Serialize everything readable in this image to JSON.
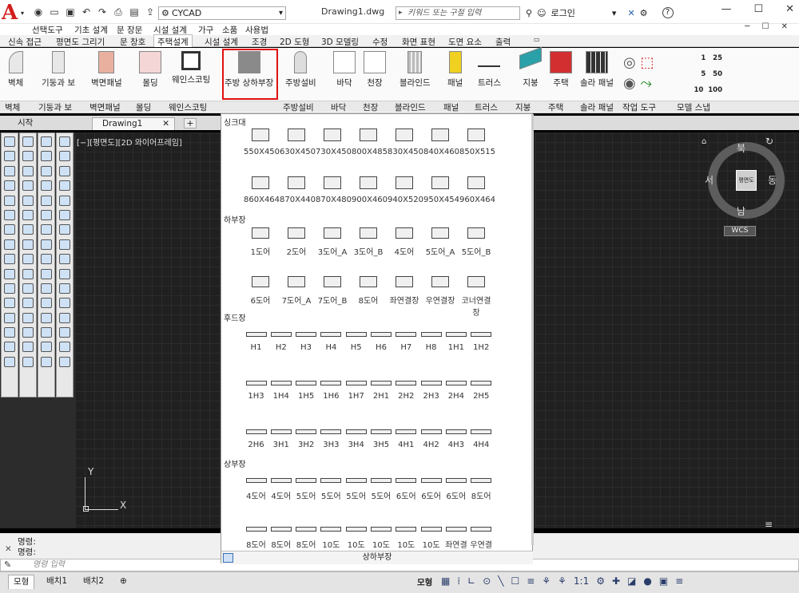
{
  "title": {
    "workspace": "CYCAD",
    "document": "Drawing1.dwg",
    "search_placeholder": "키워드 또는 구절 입력",
    "login": "로그인",
    "help": "?"
  },
  "menu": [
    "선택도구",
    "기초 설계",
    "문 장문",
    "시설 설계",
    "가구",
    "소품",
    "사용법"
  ],
  "ribbon_tabs": [
    "신속 접근",
    "평면도 그리기",
    "문 창호",
    "주택설계",
    "시설 설계",
    "조경",
    "2D 도형",
    "3D 모델링",
    "수정",
    "화면 표현",
    "도면 요소",
    "출력"
  ],
  "active_tab": "주택설계",
  "ribbon_buttons": [
    "벽체",
    "기둥과 보",
    "벽면패널",
    "몰딩",
    "웨인스코팅",
    "주방 상하부장",
    "주방설비",
    "바닥",
    "천장",
    "블라인드",
    "패널",
    "트러스",
    "지붕",
    "주택",
    "솔라 패널"
  ],
  "panel_labels": [
    "벽체",
    "기둥과 보",
    "벽면패널",
    "몰딩",
    "웨인스코팅",
    "주방설비",
    "바닥",
    "천장",
    "블라인드",
    "패널",
    "트러스",
    "지붕",
    "주택",
    "솔라 패널",
    "작업 도구",
    "모델 스냅"
  ],
  "snap_values": [
    "1",
    "25",
    "5",
    "50",
    "10",
    "100"
  ],
  "doc_tabs": {
    "start": "시작",
    "current": "Drawing1"
  },
  "viewport_label": "[−][평면도][2D 와이어프레임]",
  "viewcube": {
    "face": "평면도",
    "n": "북",
    "s": "남",
    "e": "동",
    "w": "서",
    "wcs": "WCS"
  },
  "ucs": {
    "x": "X",
    "y": "Y"
  },
  "command": {
    "line1": "명령:",
    "line2": "명령:",
    "placeholder": "명령 입력"
  },
  "layout_tabs": [
    "모형",
    "배치1",
    "배치2"
  ],
  "status_model": "모형",
  "status_scale": "1:1",
  "gallery": {
    "footer": "상하부장",
    "sections": [
      {
        "name": "싱크대",
        "rows": [
          [
            "550X450",
            "630X450",
            "730X450",
            "800X485",
            "830X450",
            "840X460",
            "850X515"
          ],
          [
            "860X464",
            "870X440",
            "870X480",
            "900X460",
            "940X520",
            "950X454",
            "960X464"
          ]
        ]
      },
      {
        "name": "하부장",
        "rows": [
          [
            "1도어",
            "2도어",
            "3도어_A",
            "3도어_B",
            "4도어",
            "5도어_A",
            "5도어_B"
          ],
          [
            "6도어",
            "7도어_A",
            "7도어_B",
            "8도어",
            "좌연결장",
            "우연결장",
            "코너연결장"
          ]
        ]
      },
      {
        "name": "후드장",
        "rows": [
          [
            "H1",
            "H2",
            "H3",
            "H4",
            "H5",
            "H6",
            "H7",
            "H8",
            "1H1",
            "1H2"
          ],
          [
            "1H3",
            "1H4",
            "1H5",
            "1H6",
            "1H7",
            "2H1",
            "2H2",
            "2H3",
            "2H4",
            "2H5"
          ],
          [
            "2H6",
            "3H1",
            "3H2",
            "3H3",
            "3H4",
            "3H5",
            "4H1",
            "4H2",
            "4H3",
            "4H4"
          ]
        ]
      },
      {
        "name": "상부장",
        "rows": [
          [
            "4도어",
            "4도어",
            "5도어",
            "5도어",
            "5도어",
            "5도어",
            "6도어",
            "6도어",
            "6도어",
            "8도어"
          ],
          [
            "8도어",
            "8도어",
            "8도어",
            "10도어",
            "10도어",
            "10도어",
            "10도어",
            "10도어",
            "좌연결",
            "우연결"
          ]
        ]
      }
    ]
  }
}
